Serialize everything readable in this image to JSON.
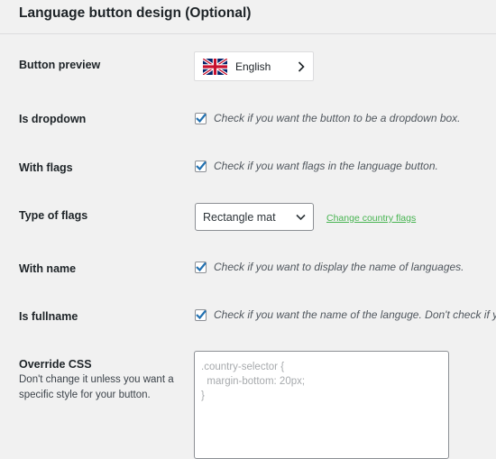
{
  "section": {
    "title": "Language button design (Optional)"
  },
  "rows": {
    "button_preview": {
      "label": "Button preview",
      "language": "English",
      "flag_icon": "uk-flag-icon",
      "arrow_icon": "chevron-right-icon"
    },
    "is_dropdown": {
      "label": "Is dropdown",
      "checked": true,
      "text": "Check if you want the button to be a dropdown box."
    },
    "with_flags": {
      "label": "With flags",
      "checked": true,
      "text": "Check if you want flags in the language button."
    },
    "type_of_flags": {
      "label": "Type of flags",
      "selected": "Rectangle mat",
      "link": "Change country flags"
    },
    "with_name": {
      "label": "With name",
      "checked": true,
      "text": "Check if you want to display the name of languages."
    },
    "is_fullname": {
      "label": "Is fullname",
      "checked": true,
      "text": "Check if you want the name of the languge. Don't check if y"
    },
    "override_css": {
      "label": "Override CSS",
      "help": "Don't change it unless you want a specific style for your button.",
      "placeholder_lines": [
        ".country-selector {",
        "  margin-bottom: 20px;",
        "}"
      ]
    }
  },
  "colors": {
    "background": "#f1f1f1",
    "checkmark": "#2271b1",
    "link": "#46b450"
  }
}
